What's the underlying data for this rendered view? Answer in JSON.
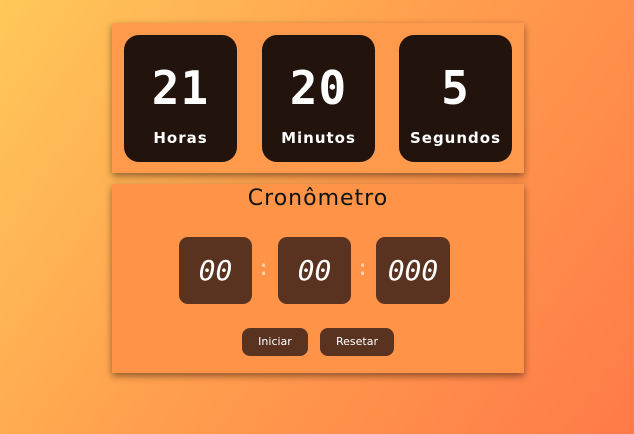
{
  "clock": {
    "hours_value": "21",
    "hours_label": "Horas",
    "minutes_value": "20",
    "minutes_label": "Minutos",
    "seconds_value": "5",
    "seconds_label": "Segundos"
  },
  "stopwatch": {
    "title": "Cronômetro",
    "minutes": "00",
    "seconds": "00",
    "milliseconds": "000",
    "separator": ":",
    "start_label": "Iniciar",
    "reset_label": "Resetar"
  },
  "colors": {
    "background_start": "#ffc85a",
    "background_end": "#ff7a48",
    "panel": "#ff9a4d",
    "clock_box": "#22130d",
    "digit_box": "#5a3320",
    "button": "#5a3320"
  }
}
